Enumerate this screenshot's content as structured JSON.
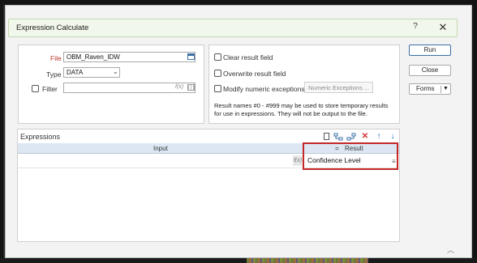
{
  "dialog": {
    "title": "Expression Calculate",
    "help": "?",
    "close": "✕"
  },
  "left_panel": {
    "file_label": "File",
    "file_value": "OBM_Raven_IDW",
    "type_label": "Type",
    "type_value": "DATA",
    "filter_label": "Filter",
    "filter_value": "",
    "fx_label": "f(x)"
  },
  "options": {
    "clear_result": "Clear result field",
    "overwrite_result": "Overwrite result field",
    "modify_numeric": "Modify numeric exceptions",
    "numeric_exceptions_button": "Numeric Exceptions ...",
    "note": "Result names #0 - #999 may be used to store temporary results for use in expressions. They will not be output to the file."
  },
  "buttons": {
    "run": "Run",
    "close": "Close",
    "forms": "Forms"
  },
  "expressions": {
    "title": "Expressions",
    "col_input": "Input",
    "col_eq": "=",
    "col_result": "Result",
    "rows": [
      {
        "input": "",
        "result": "Confidence Level"
      }
    ]
  },
  "colors": {
    "highlight": "#c62828",
    "titlebar": "#f1f7ea",
    "header": "#dce7f3"
  }
}
